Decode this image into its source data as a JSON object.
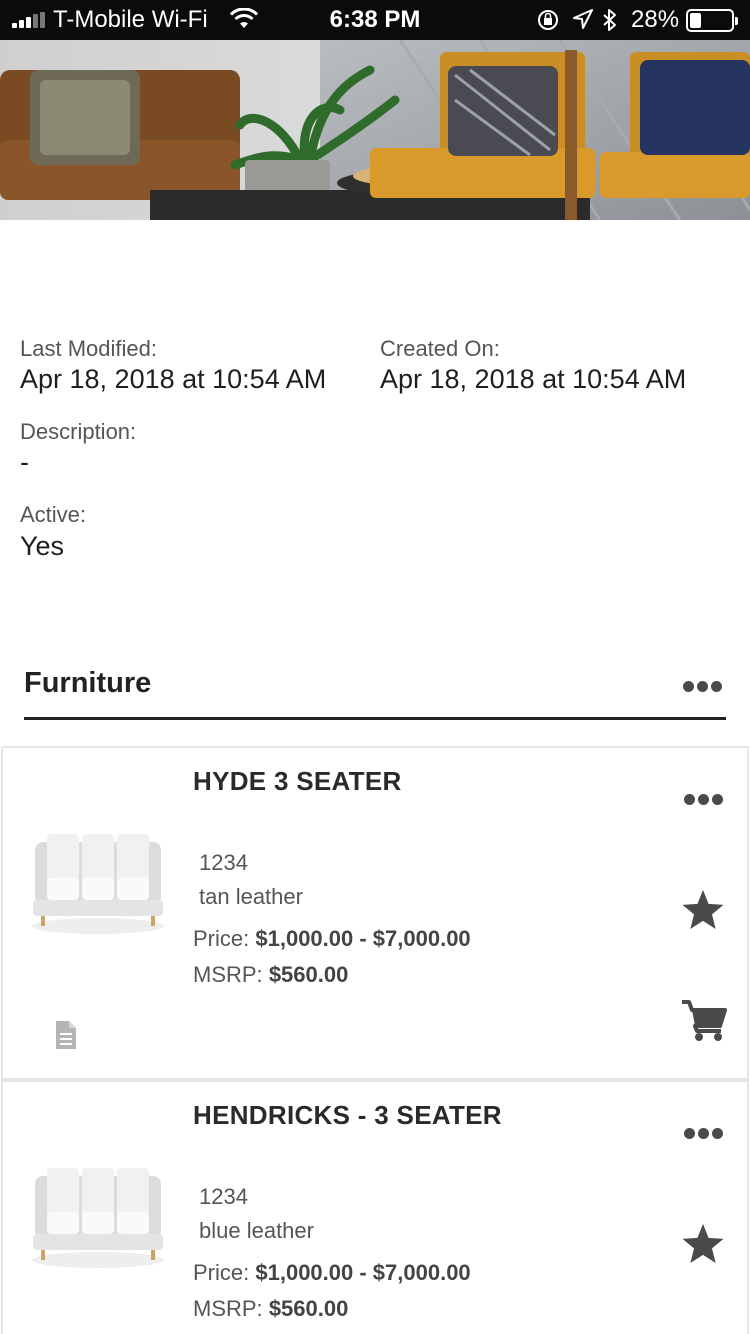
{
  "status_bar": {
    "carrier": "T-Mobile Wi-Fi",
    "time": "6:38 PM",
    "battery": "28%",
    "battery_level": 0.28
  },
  "meta": {
    "last_modified_label": "Last Modified:",
    "last_modified_value": "Apr 18, 2018 at 10:54 AM",
    "created_on_label": "Created On:",
    "created_on_value": "Apr 18, 2018 at 10:54 AM",
    "description_label": "Description:",
    "description_value": "-",
    "active_label": "Active:",
    "active_value": "Yes"
  },
  "section": {
    "title": "Furniture"
  },
  "products": [
    {
      "name": "HYDE 3 SEATER",
      "sku": "1234",
      "material": "tan leather",
      "price_label": "Price:",
      "price_value": "$1,000.00 - $7,000.00",
      "msrp_label": "MSRP:",
      "msrp_value": "$560.00"
    },
    {
      "name": "HENDRICKS - 3 SEATER",
      "sku": "1234",
      "material": "blue leather",
      "price_label": "Price:",
      "price_value": "$1,000.00 - $7,000.00",
      "msrp_label": "MSRP:",
      "msrp_value": "$560.00"
    }
  ],
  "icons": {
    "more": "more-horizontal-icon",
    "favorite": "star-icon",
    "cart": "shopping-cart-icon",
    "document": "document-icon"
  },
  "colors": {
    "icon": "#4a4a4a",
    "rule": "#222222",
    "card_border": "#e6e6e6"
  }
}
